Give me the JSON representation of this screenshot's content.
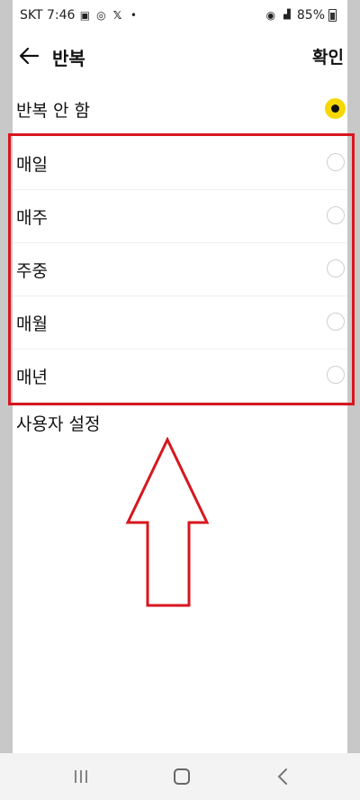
{
  "status_bar": {
    "carrier_time": "SKT 7:46",
    "battery": "85%"
  },
  "header": {
    "title": "반복",
    "confirm_label": "확인"
  },
  "options": [
    {
      "label": "반복 안 함",
      "selected": true
    },
    {
      "label": "매일",
      "selected": false
    },
    {
      "label": "매주",
      "selected": false
    },
    {
      "label": "주중",
      "selected": false
    },
    {
      "label": "매월",
      "selected": false
    },
    {
      "label": "매년",
      "selected": false
    }
  ],
  "custom": {
    "label": "사용자 설정"
  },
  "colors": {
    "accent": "#f5d800",
    "highlight": "#d8161e"
  },
  "icons": [
    "back-arrow-icon",
    "recent-apps-icon",
    "home-icon",
    "back-icon"
  ]
}
